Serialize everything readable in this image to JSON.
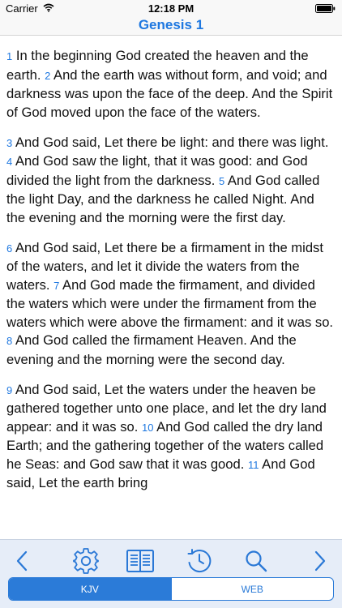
{
  "status_bar": {
    "carrier": "Carrier",
    "time": "12:18 PM"
  },
  "nav": {
    "title": "Genesis 1"
  },
  "content": {
    "paragraphs": [
      [
        {
          "n": "1",
          "t": "In the beginning God created the heaven and the earth."
        },
        {
          "n": "2",
          "t": "And the earth was without form, and void; and darkness was upon the face of the deep. And the Spirit of God moved upon the face of the waters."
        }
      ],
      [
        {
          "n": "3",
          "t": "And God said, Let there be light: and there was light."
        },
        {
          "n": "4",
          "t": "And God saw the light, that it was good: and God divided the light from the darkness."
        },
        {
          "n": "5",
          "t": "And God called the light Day, and the darkness he called Night. And the evening and the morning were the first day."
        }
      ],
      [
        {
          "n": "6",
          "t": "And God said, Let there be a firmament in the midst of the waters, and let it divide the waters from the waters."
        },
        {
          "n": "7",
          "t": "And God made the firmament, and divided the waters which were under the firmament from the waters which were above the firmament: and it was so."
        },
        {
          "n": "8",
          "t": "And God called the firmament Heaven. And the evening and the morning were the second day."
        }
      ],
      [
        {
          "n": "9",
          "t": "And God said, Let the waters under the heaven be gathered together unto one place, and let the dry land appear: and it was so."
        },
        {
          "n": "10",
          "t": "And God called the dry land Earth; and the gathering together of the waters called he Seas: and God saw that it was good."
        },
        {
          "n": "11",
          "t": "And God said, Let the earth bring"
        }
      ]
    ]
  },
  "toolbar": {
    "icons": [
      "chevron-left-icon",
      "gear-icon",
      "book-icon",
      "history-clock-icon",
      "search-icon",
      "chevron-right-icon"
    ]
  },
  "version_selector": {
    "options": [
      "KJV",
      "WEB"
    ],
    "selected": "KJV"
  },
  "colors": {
    "accent": "#1f78e0",
    "toolbar_bg": "#e6edf8"
  }
}
